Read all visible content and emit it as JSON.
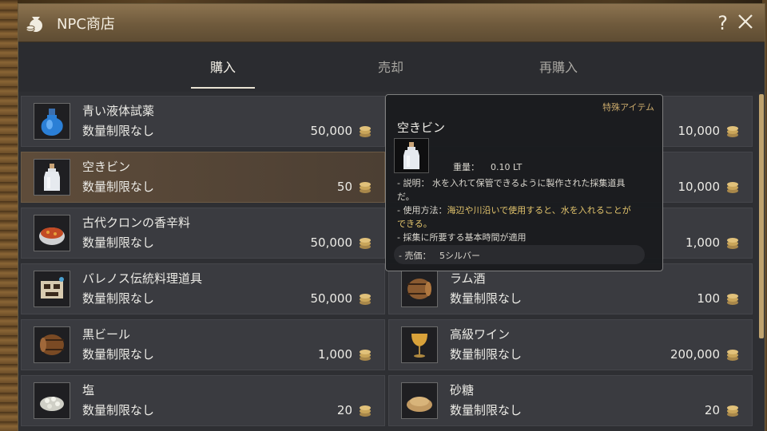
{
  "window": {
    "title": "NPC商店",
    "help_label": "?"
  },
  "tabs": [
    {
      "label": "購入",
      "active": true
    },
    {
      "label": "売却",
      "active": false
    },
    {
      "label": "再購入",
      "active": false
    }
  ],
  "items_left": [
    {
      "name": "青い液体試薬",
      "limit": "数量制限なし",
      "price": "50,000",
      "icon": "blue-potion-icon"
    },
    {
      "name": "空きビン",
      "limit": "数量制限なし",
      "price": "50",
      "icon": "empty-bottle-icon",
      "selected": true
    },
    {
      "name": "古代クロンの香辛料",
      "limit": "数量制限なし",
      "price": "50,000",
      "icon": "spice-bowl-icon"
    },
    {
      "name": "バレノス伝統料理道具",
      "limit": "数量制限なし",
      "price": "50,000",
      "icon": "cooking-utensil-icon"
    },
    {
      "name": "黒ビール",
      "limit": "数量制限なし",
      "price": "1,000",
      "icon": "beer-barrel-icon"
    },
    {
      "name": "塩",
      "limit": "数量制限なし",
      "price": "20",
      "icon": "salt-icon"
    }
  ],
  "items_right": [
    {
      "name": "",
      "limit": "",
      "price": "10,000",
      "icon": ""
    },
    {
      "name": "",
      "limit": "",
      "price": "10,000",
      "icon": ""
    },
    {
      "name": "",
      "limit": "",
      "price": "1,000",
      "icon": ""
    },
    {
      "name": "ラム酒",
      "limit": "数量制限なし",
      "price": "100",
      "icon": "rum-barrel-icon"
    },
    {
      "name": "高級ワイン",
      "limit": "数量制限なし",
      "price": "200,000",
      "icon": "wine-glass-icon"
    },
    {
      "name": "砂糖",
      "limit": "数量制限なし",
      "price": "20",
      "icon": "sugar-icon"
    }
  ],
  "tooltip": {
    "category": "特殊アイテム",
    "name": "空きビン",
    "weight_label": "重量：",
    "weight_value": "0.10 LT",
    "desc_line1": "- 説明： 水を入れて保管できるように製作された採集道具",
    "desc_line2": "だ。",
    "usage_prefix": "- 使用方法：",
    "usage_line1": "海辺や川沿いで使用すると、水を入れることが",
    "usage_line2": "できる。",
    "gather_time": "- 採集に所要する基本時間が適用",
    "sell_label": "- 売価：",
    "sell_value": "5シルバー"
  },
  "colors": {
    "title_bar": "#7a6446",
    "panel_bg": "#2e2f33",
    "item_bg": "#3a3b40",
    "selected_bg": "#5e4c3a",
    "tooltip_accent": "#c9a96b",
    "highlight_text": "#e2c46c",
    "coin": "#c9a55a"
  }
}
